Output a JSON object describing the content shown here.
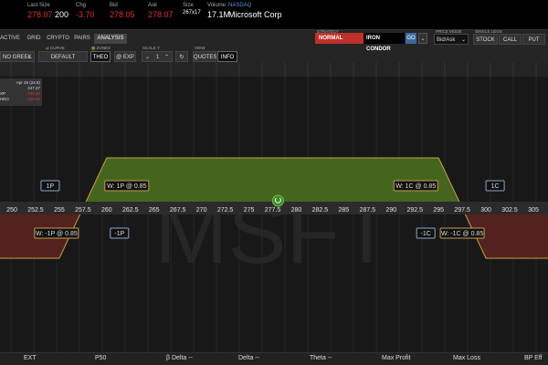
{
  "quote": {
    "last_size_label": "Last Size",
    "last_price": "278.07",
    "last_size": "200",
    "chg_label": "Chg",
    "chg": "-3.70",
    "bid_label": "Bid",
    "bid": "278.05",
    "ask_label": "Ask",
    "ask": "278.07",
    "size_label": "Size",
    "size": "267x17",
    "volume_label": "Volume",
    "volume": "17.1M",
    "exchange": "NASDAQ",
    "company": "Microsoft Corp"
  },
  "tabs": [
    "ACTIVE",
    "GRID",
    "CRYPTO",
    "PAIRS",
    "ANALYSIS"
  ],
  "active_tab": "ANALYSIS",
  "strategy": {
    "label": "STRATEGY",
    "mode": "NORMAL",
    "name": "IRON CONDOR",
    "go": "GO"
  },
  "price_mode": {
    "label": "PRICE MODE",
    "value": "Bid/Ask"
  },
  "single_legs": {
    "label": "SINGLE LEGS",
    "buttons": [
      "STOCK",
      "CALL",
      "PUT"
    ]
  },
  "toolbar2": {
    "greek": "NO GREEK",
    "curve_label": "CURVE",
    "curve": "DEFAULT ANALYSIS",
    "zones_label": "ZONES",
    "theo": "THEO",
    "exp": "@ EXP",
    "scale_label": "SCALE Y",
    "scale_value": "1",
    "view_label": "VIEW",
    "quotes": "QUOTES",
    "info": "INFO"
  },
  "info_box": {
    "date": "Apr 25 (24.8)",
    "price": "247.27",
    "exp": "-155.90",
    "theo": "-155.90"
  },
  "watermark": "MSFT",
  "chart_data": {
    "type": "line",
    "x": [
      250,
      252.5,
      255,
      257.5,
      260,
      262.5,
      265,
      267.5,
      270,
      272.5,
      275,
      277.5,
      280,
      282.5,
      285,
      287.5,
      290,
      292.5,
      295,
      297.5,
      300,
      302.5,
      305
    ],
    "x_labels": [
      "250",
      "252.5",
      "255",
      "257.5",
      "260",
      "262.5",
      "265",
      "267.5",
      "270",
      "272.5",
      "275",
      "277.5",
      "280",
      "282.5",
      "285",
      "287.5",
      "290",
      "292.5",
      "295",
      "297.5",
      "300",
      "302.5",
      "305"
    ],
    "series": [
      {
        "x": [
          245,
          255,
          260,
          295,
          300,
          310
        ],
        "y": [
          -1,
          -1,
          1,
          1,
          -1,
          -1
        ]
      }
    ],
    "current_price": 278.07,
    "annotations": [
      {
        "text": "1P",
        "strike": 255
      },
      {
        "text": "-1P",
        "strike": 260
      },
      {
        "text": "-1C",
        "strike": 295
      },
      {
        "text": "1C",
        "strike": 300
      },
      {
        "text": "W: 1P @ 0.85"
      },
      {
        "text": "W: -1P @ 0.85"
      },
      {
        "text": "W: 1C @ 0.85"
      },
      {
        "text": "W: -1C @ 0.85"
      }
    ],
    "colors": {
      "profit": "#4a6e1f",
      "loss": "#5a2220",
      "line": "#c8a048"
    }
  },
  "bottom": [
    "EXT",
    "P50",
    "β Delta --",
    "Delta --",
    "Theta --",
    "Max Profit",
    "Max Loss",
    "BP Eff"
  ],
  "colors": {
    "red": "#e03030",
    "strategy_red": "#c0302a",
    "go_blue": "#3a6a9a",
    "profit_green": "#4a6e1f",
    "loss_red": "#5a2220"
  }
}
